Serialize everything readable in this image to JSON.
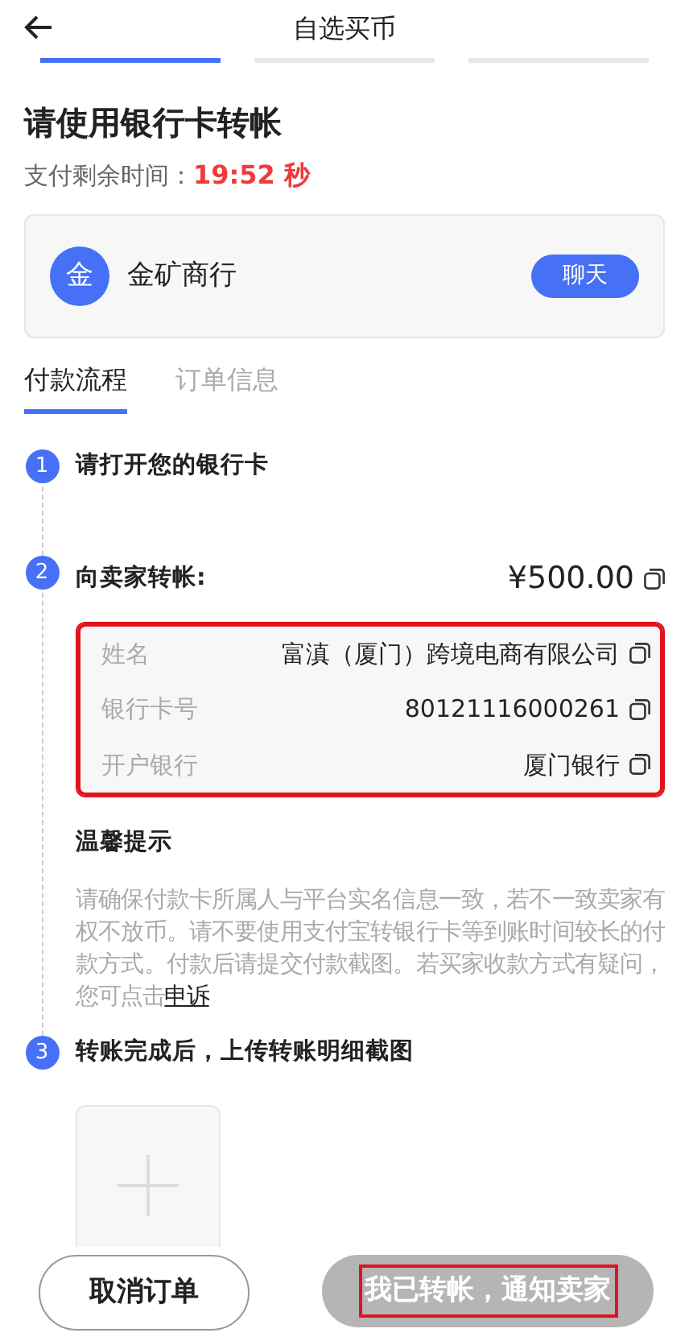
{
  "header": {
    "title": "自选买币"
  },
  "progress_steps": [
    {
      "selected": true
    },
    {
      "selected": false
    },
    {
      "selected": false
    }
  ],
  "heading": "请使用银行卡转帐",
  "timer": {
    "label": "支付剩余时间：",
    "value": "19:52 秒"
  },
  "merchant": {
    "avatar": "金",
    "name": "金矿商行",
    "chat_button": "聊天"
  },
  "tabs": [
    {
      "label": "付款流程",
      "selected": true
    },
    {
      "label": "订单信息",
      "selected": false
    }
  ],
  "steps": [
    {
      "number": "1",
      "title": "请打开您的银行卡"
    },
    {
      "number": "2",
      "title": "向卖家转帐:",
      "amount": "¥500.00",
      "details": {
        "highlighted": true,
        "rows": [
          {
            "label": "姓名",
            "value": "富滇（厦门）跨境电商有限公司"
          },
          {
            "label": "银行卡号",
            "value": "80121116000261"
          },
          {
            "label": "开户银行",
            "value": "厦门银行"
          }
        ]
      },
      "notice": {
        "title": "温馨提示",
        "text": "请确保付款卡所属人与平台实名信息一致，若不一致卖家有权不放币。请不要使用支付宝转银行卡等到账时间较长的付款方式。付款后请提交付款截图。若买家收款方式有疑问，您可点击",
        "link": "申诉"
      }
    },
    {
      "number": "3",
      "title": "转账完成后，上传转账明细截图",
      "upload": true
    }
  ],
  "buttons": {
    "cancel": {
      "label": "取消订单"
    },
    "confirm": {
      "label": "我已转帐，通知卖家",
      "disabled": true,
      "highlighted": true
    }
  }
}
